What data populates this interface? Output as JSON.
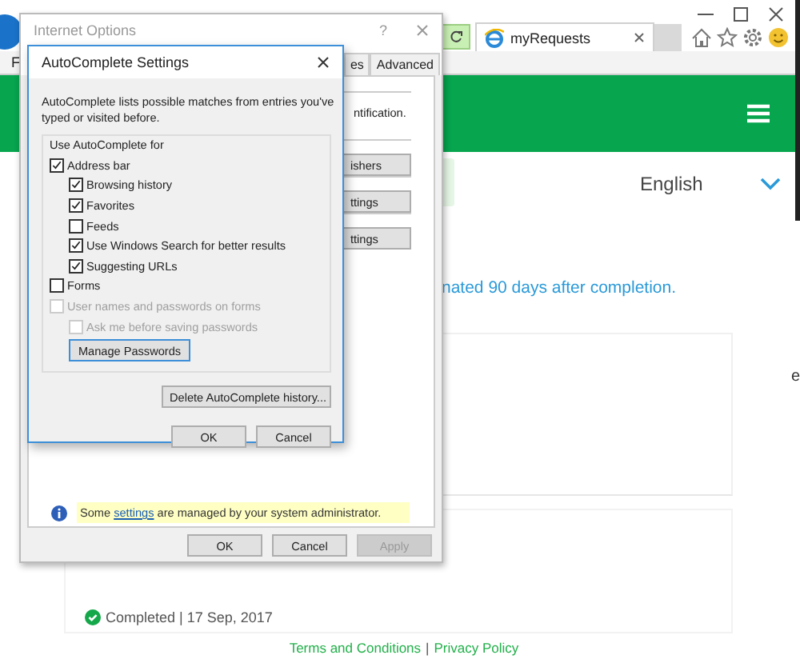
{
  "browser": {
    "menu_text": "F",
    "tab": {
      "title": "myRequests"
    }
  },
  "page": {
    "language": "English",
    "notice": "nated 90 days after completion.",
    "status": "Completed | 17 Sep, 2017",
    "edge_text": "e",
    "footer": {
      "links": [
        "Terms and Conditions",
        "Privacy Policy"
      ],
      "separator": "|"
    }
  },
  "internet_options": {
    "title": "Internet Options",
    "help": "?",
    "tabs": [
      {
        "label": "es",
        "selected": false
      },
      {
        "label": "Advanced",
        "selected": false
      }
    ],
    "sections": [
      {
        "kind": "text",
        "text": "ntification."
      },
      {
        "kind": "button",
        "label": "ishers"
      },
      {
        "kind": "button",
        "label": "ttings"
      },
      {
        "kind": "button",
        "label": "ttings"
      }
    ],
    "info": {
      "before": "Some ",
      "link": "settings",
      "after": " are managed by your system administrator."
    },
    "buttons": [
      {
        "label": "OK",
        "disabled": false
      },
      {
        "label": "Cancel",
        "disabled": false
      },
      {
        "label": "Apply",
        "disabled": true
      }
    ]
  },
  "autocomplete": {
    "title": "AutoComplete Settings",
    "description": "AutoComplete lists possible matches from entries you've typed or visited before.",
    "group_label": "Use AutoComplete for",
    "options": [
      {
        "kind": "checkbox",
        "label": "Address bar",
        "checked": true,
        "disabled": false,
        "children": [
          {
            "kind": "checkbox",
            "label": "Browsing history",
            "checked": true,
            "disabled": false
          },
          {
            "kind": "checkbox",
            "label": "Favorites",
            "checked": true,
            "disabled": false
          },
          {
            "kind": "checkbox",
            "label": "Feeds",
            "checked": false,
            "disabled": false
          },
          {
            "kind": "checkbox",
            "label": "Use Windows Search for better results",
            "checked": true,
            "disabled": false
          },
          {
            "kind": "checkbox",
            "label": "Suggesting URLs",
            "checked": true,
            "disabled": false
          }
        ]
      },
      {
        "kind": "checkbox",
        "label": "Forms",
        "checked": false,
        "disabled": false
      },
      {
        "kind": "checkbox",
        "label": "User names and passwords on forms",
        "checked": false,
        "disabled": true,
        "children": [
          {
            "kind": "checkbox",
            "label": "Ask me before saving passwords",
            "checked": false,
            "disabled": true
          },
          {
            "kind": "button",
            "label": "Manage Passwords"
          }
        ]
      }
    ],
    "delete_button": "Delete AutoComplete history...",
    "buttons": [
      {
        "label": "OK",
        "disabled": false
      },
      {
        "label": "Cancel",
        "disabled": false
      }
    ]
  }
}
